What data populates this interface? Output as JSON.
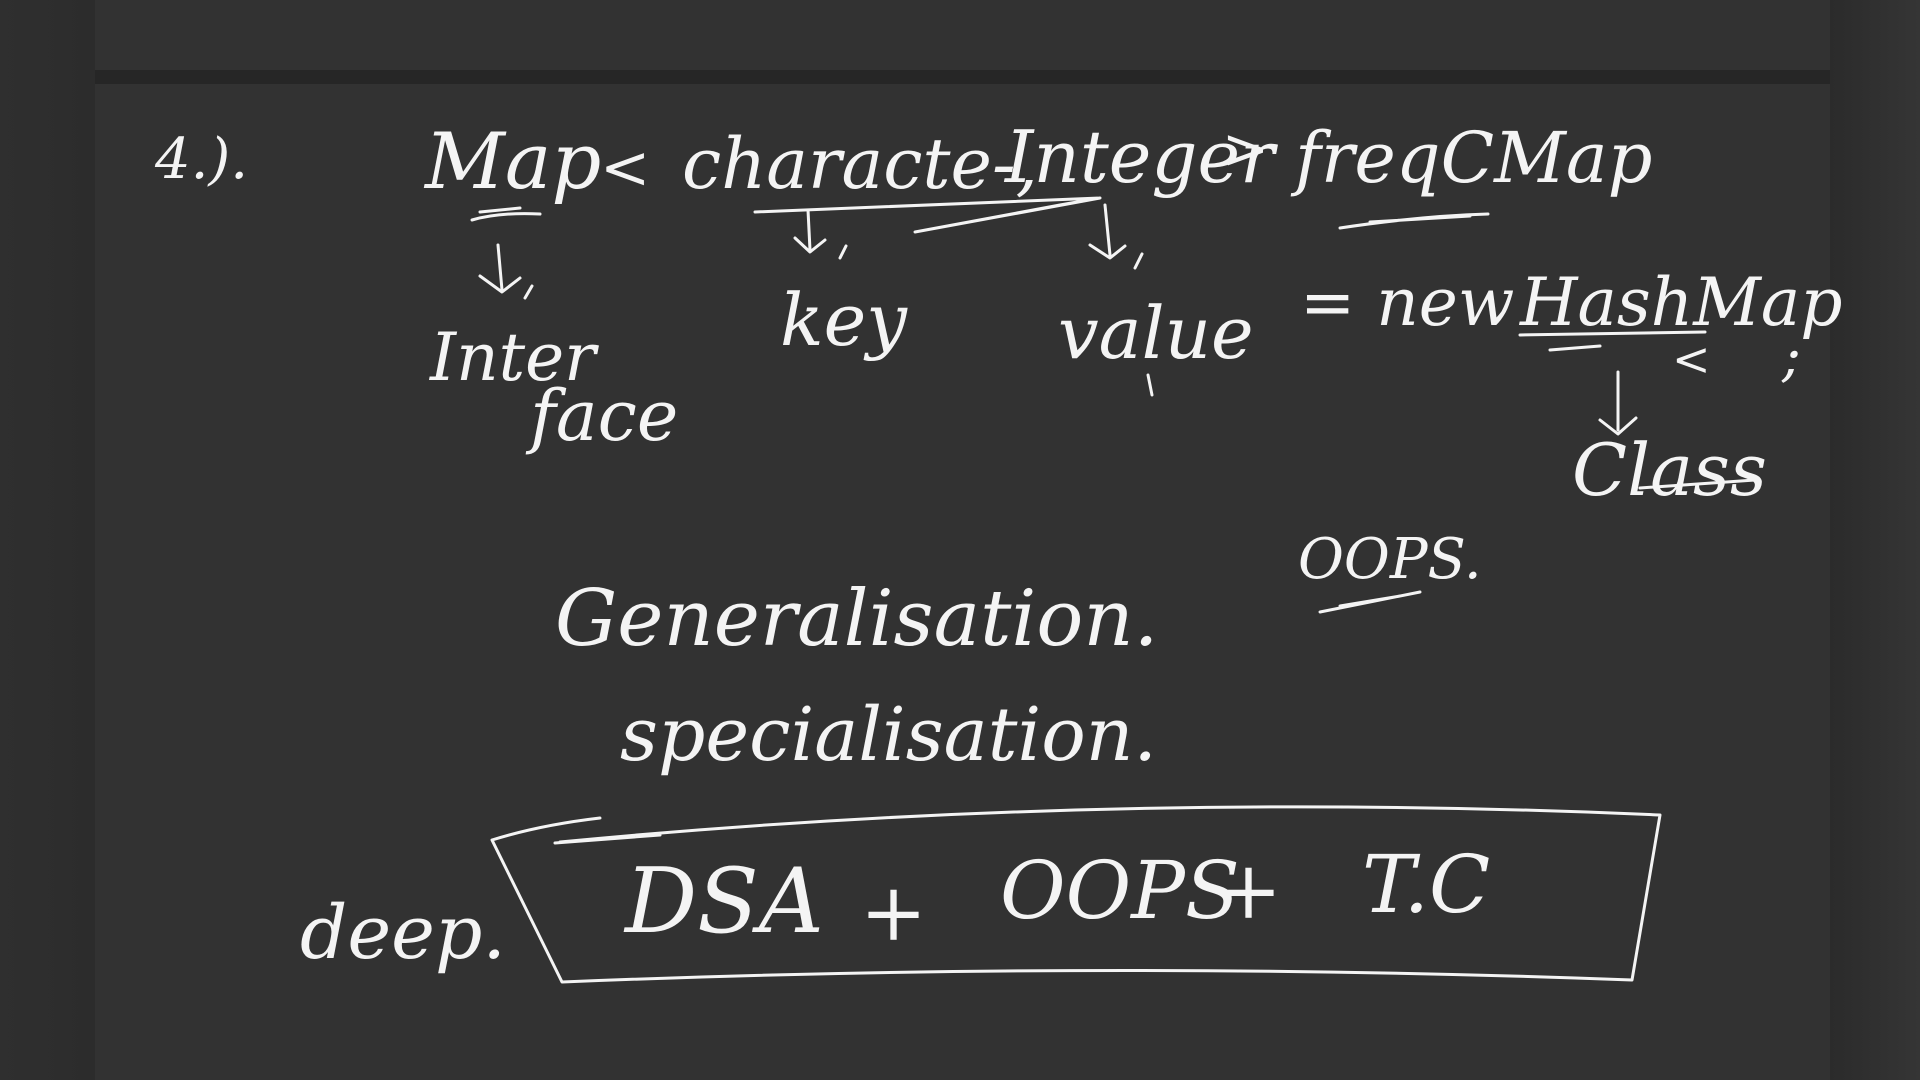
{
  "board": {
    "item_number": "4.).",
    "line1": {
      "map_word": "Map",
      "lt": "<",
      "character": "characte-,",
      "integer": "Integer",
      "gt": ">",
      "var_name": "freqCMap"
    },
    "labels": {
      "interface_1": "Inter",
      "interface_2": "face",
      "key": "key",
      "value": "value",
      "new_expr": "= new",
      "hashmap": "HashMap",
      "generic_lt": "<",
      "semicolon": ";",
      "class": "Class"
    },
    "oops_note": "OOPS.",
    "generalisation": "Generalisation.",
    "specialisation": "specialisation.",
    "deep_label": "deep.",
    "boxed_text": {
      "dsa": "DSA",
      "plus1": "+",
      "oops": "OOPS",
      "plus2": "+",
      "tc": "T.C"
    }
  },
  "colors": {
    "ink": "#f4f4f4",
    "board": "#323232",
    "frame": "#2a2a2a"
  }
}
